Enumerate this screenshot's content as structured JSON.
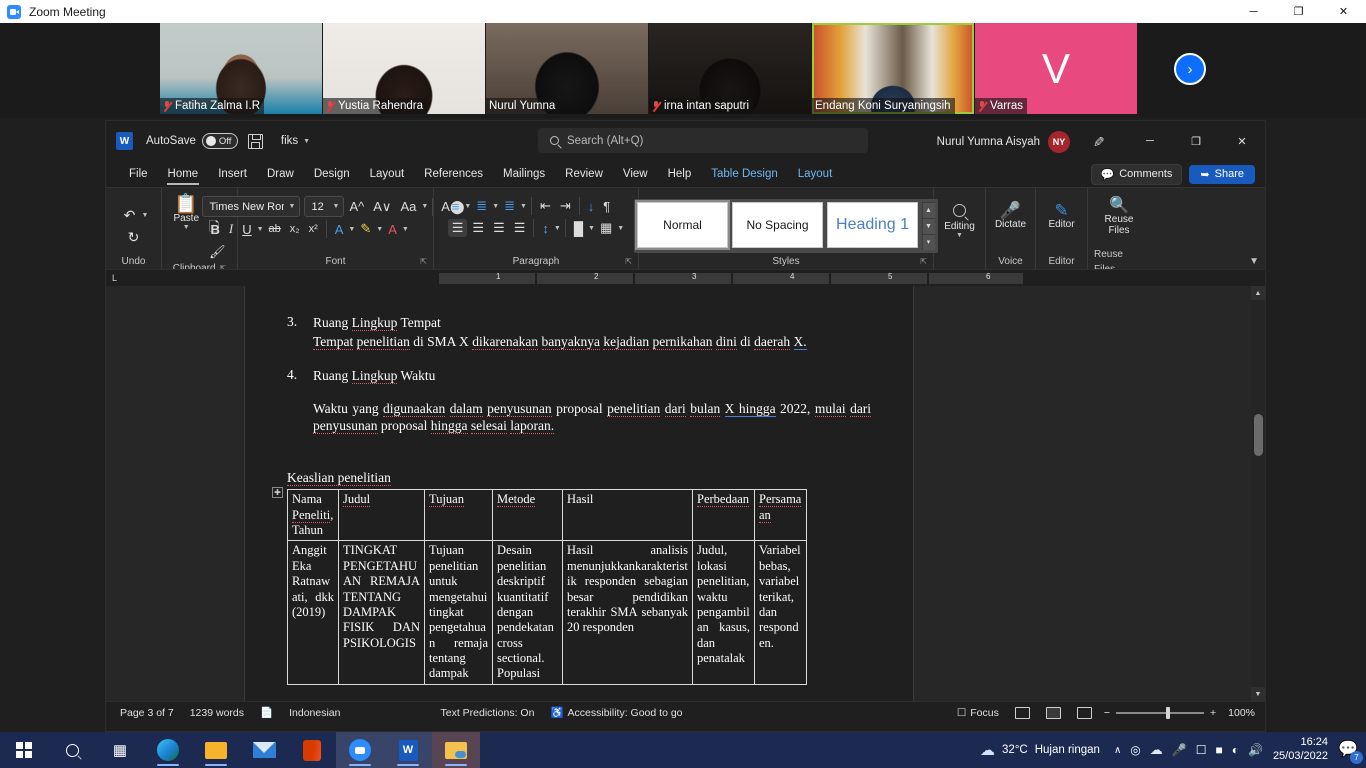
{
  "zoom_window": {
    "title": "Zoom Meeting",
    "window_controls": {
      "minimize": "─",
      "maximize": "❐",
      "close": "✕"
    },
    "participants": [
      {
        "name": "Fatiha Zalma I.R",
        "muted": true,
        "avatar_letter": "",
        "active_speaker": false
      },
      {
        "name": "Yustia Rahendra",
        "muted": true,
        "avatar_letter": "",
        "active_speaker": false
      },
      {
        "name": "Nurul Yumna",
        "muted": false,
        "avatar_letter": "",
        "active_speaker": false
      },
      {
        "name": "irna intan saputri",
        "muted": true,
        "avatar_letter": "",
        "active_speaker": false
      },
      {
        "name": "Endang Koni Suryaningsih",
        "muted": false,
        "avatar_letter": "",
        "active_speaker": true
      },
      {
        "name": "Varras",
        "muted": true,
        "avatar_letter": "V",
        "active_speaker": false
      }
    ],
    "next_page_arrow": "›",
    "active_speaker_color": "#9ccc3a",
    "avatar_color": "#e84a7f"
  },
  "word": {
    "app_icon_letter": "W",
    "autosave": {
      "label": "AutoSave",
      "state": "Off"
    },
    "save_icon": "save-icon",
    "filename": "fiks",
    "search": {
      "placeholder": "Search (Alt+Q)"
    },
    "account": {
      "name": "Nurul Yumna Aisyah",
      "initials": "NY",
      "color": "#a4262c"
    },
    "window_controls": {
      "minimize": "─",
      "restore": "❐",
      "close": "✕"
    },
    "tabs": [
      {
        "label": "File",
        "active": false,
        "contextual": false
      },
      {
        "label": "Home",
        "active": true,
        "contextual": false
      },
      {
        "label": "Insert",
        "active": false,
        "contextual": false
      },
      {
        "label": "Draw",
        "active": false,
        "contextual": false
      },
      {
        "label": "Design",
        "active": false,
        "contextual": false
      },
      {
        "label": "Layout",
        "active": false,
        "contextual": false
      },
      {
        "label": "References",
        "active": false,
        "contextual": false
      },
      {
        "label": "Mailings",
        "active": false,
        "contextual": false
      },
      {
        "label": "Review",
        "active": false,
        "contextual": false
      },
      {
        "label": "View",
        "active": false,
        "contextual": false
      },
      {
        "label": "Help",
        "active": false,
        "contextual": false
      },
      {
        "label": "Table Design",
        "active": false,
        "contextual": true
      },
      {
        "label": "Layout",
        "active": false,
        "contextual": true
      }
    ],
    "comments_label": "Comments",
    "share_label": "Share",
    "groups": {
      "undo": {
        "label": "Undo"
      },
      "clipboard": {
        "label": "Clipboard",
        "paste_label": "Paste"
      },
      "font": {
        "label": "Font",
        "font_family": "Times New Roman",
        "font_size": "12",
        "bold": "B",
        "italic": "I",
        "underline": "U",
        "strikethrough": "ab",
        "subscript": "x₂",
        "superscript": "x²"
      },
      "paragraph": {
        "label": "Paragraph"
      },
      "styles": {
        "label": "Styles",
        "items": [
          {
            "name": "Normal",
            "selected": true
          },
          {
            "name": "No Spacing",
            "selected": false
          },
          {
            "name": "Heading 1",
            "selected": false
          }
        ]
      },
      "editing": {
        "label": "Editing"
      },
      "voice": {
        "label": "Voice",
        "button": "Dictate"
      },
      "editor": {
        "label": "Editor",
        "button": "Editor"
      },
      "reuse": {
        "label": "Reuse Files",
        "button_line1": "Reuse",
        "button_line2": "Files"
      }
    },
    "ruler": {
      "left_tab_marker": "L",
      "numbers": [
        "1",
        "2",
        "3",
        "4",
        "5",
        "6"
      ]
    },
    "status_bar": {
      "page": "Page 3 of 7",
      "words": "1239 words",
      "proofing_icon": "proofing-errors-icon",
      "language": "Indonesian",
      "text_predictions": "Text Predictions: On",
      "accessibility": "Accessibility: Good to go",
      "focus": "Focus",
      "view_read": "read-mode-icon",
      "view_print": "print-layout-icon",
      "view_web": "web-layout-icon",
      "zoom_out": "−",
      "zoom_in": "+",
      "zoom_level": "100%"
    }
  },
  "document": {
    "items": [
      {
        "number": "3.",
        "heading": "Ruang Lingkup Tempat",
        "body": "Tempat penelitian di SMA X dikarenakan banyaknya kejadian pernikahan dini di daerah X."
      },
      {
        "number": "4.",
        "heading": "Ruang Lingkup Waktu",
        "body": "Waktu yang digunaakan dalam penyusunan proposal penelitian dari bulan X hingga 2022, mulai dari penyusunan proposal hingga selesai laporan."
      }
    ],
    "table_caption": "Keaslian penelitian",
    "table": {
      "headers": [
        "Nama Peneliti, Tahun",
        "Judul",
        "Tujuan",
        "Metode",
        "Hasil",
        "Perbedaan",
        "Persamaan"
      ],
      "rows": [
        [
          "Anggit Eka Ratnawati, dkk (2019)",
          "TINGKAT PENGETAHUAN REMAJA TENTANG DAMPAK FISIK DAN PSIKOLOGIS",
          "Tujuan penelitian untuk mengetahui tingkat pengetahuan remaja tentang dampak",
          "Desain penelitian deskriptif kuantitatif dengan pendekatan cross sectional. Populasi",
          "Hasil analisis menunjukkankarakteristik responden sebagian besar pendidikan terakhir SMA sebanyak 20 responden",
          "Judul, lokasi penelitian, waktu pengambilan kasus, dan penatalak",
          "Variabel bebas, variabel terikat, dan responden."
        ]
      ]
    }
  },
  "taskbar": {
    "start": "start-button",
    "search": "search-icon",
    "task_view": "task-view-icon",
    "apps": [
      {
        "name": "microsoft-edge",
        "running": true
      },
      {
        "name": "file-explorer",
        "running": true
      },
      {
        "name": "mail",
        "running": false
      },
      {
        "name": "microsoft-office",
        "running": false
      },
      {
        "name": "zoom",
        "running": true
      },
      {
        "name": "microsoft-word",
        "running": true
      },
      {
        "name": "onedrive-folder",
        "running": true
      }
    ],
    "weather": {
      "temperature": "32°C",
      "condition": "Hujan ringan"
    },
    "tray": {
      "expand": "∧",
      "icons": [
        "zoom-tray-icon",
        "onedrive-icon",
        "microphone-icon",
        "screenshot-icon",
        "battery-icon",
        "wifi-icon",
        "volume-icon"
      ]
    },
    "clock": {
      "time": "16:24",
      "date": "25/03/2022"
    },
    "notifications": {
      "icon": "notification-icon",
      "count": "7"
    }
  }
}
